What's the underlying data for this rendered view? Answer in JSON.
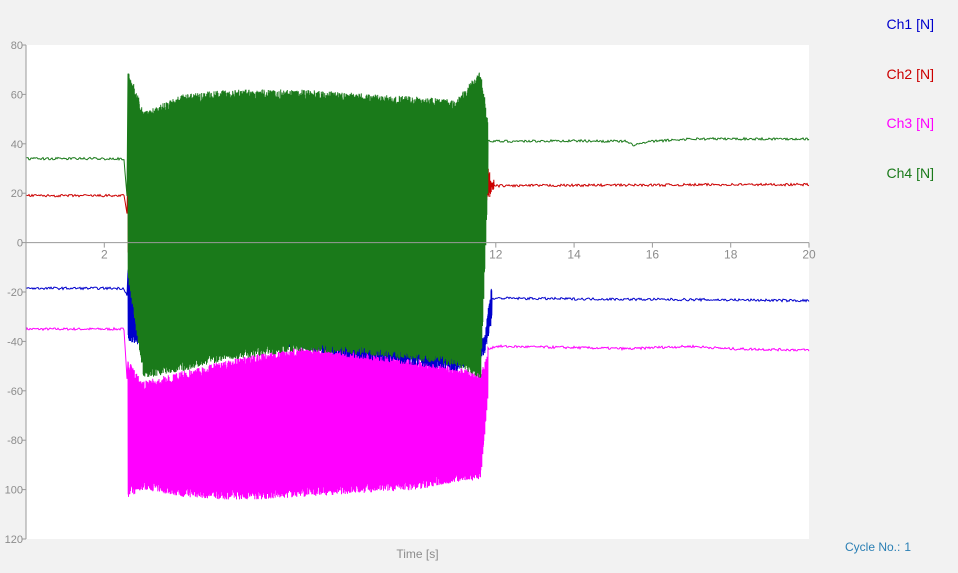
{
  "chart_data": {
    "type": "line",
    "title": "",
    "xlabel": "Time [s]",
    "ylabel": "",
    "xlim": [
      0,
      20
    ],
    "ylim": [
      -120,
      80
    ],
    "xticks": [
      2,
      12,
      14,
      16,
      18,
      20
    ],
    "yticks": [
      80,
      60,
      40,
      20,
      0,
      -20,
      -40,
      -60,
      -80,
      -100,
      -120
    ],
    "ytick_labels": [
      "80",
      "60",
      "40",
      "20",
      "0",
      "-20",
      "-40",
      "-60",
      "-80",
      "100",
      "120"
    ],
    "grid": false,
    "legend": "right",
    "series": [
      {
        "name": "Ch1 [N]",
        "color": "#0000cc",
        "points": [
          [
            0,
            -18.5
          ],
          [
            2.5,
            -18.5
          ],
          [
            2.6,
            -22
          ],
          [
            3,
            -28
          ],
          [
            4,
            -30
          ],
          [
            5,
            -33
          ],
          [
            6,
            -35
          ],
          [
            7,
            -37
          ],
          [
            8,
            -40
          ],
          [
            9,
            -42
          ],
          [
            10,
            -44
          ],
          [
            11,
            -45
          ],
          [
            11.7,
            -44
          ],
          [
            11.9,
            -23
          ],
          [
            12,
            -22.5
          ],
          [
            14,
            -22.8
          ],
          [
            16,
            -23
          ],
          [
            18,
            -23.2
          ],
          [
            20,
            -23.5
          ]
        ],
        "band": [
          [
            2.6,
            -8,
            -40
          ],
          [
            3,
            -14,
            -42
          ],
          [
            4,
            -20,
            -42
          ],
          [
            5,
            -25,
            -41
          ],
          [
            6,
            -28,
            -41
          ],
          [
            7,
            -32,
            -43
          ],
          [
            8,
            -35,
            -46
          ],
          [
            9,
            -38,
            -48
          ],
          [
            10,
            -40,
            -50
          ],
          [
            11,
            -41,
            -52
          ],
          [
            11.7,
            -38,
            -46
          ],
          [
            11.9,
            -15,
            -30
          ]
        ]
      },
      {
        "name": "Ch2 [N]",
        "color": "#cc0000",
        "points": [
          [
            0,
            19
          ],
          [
            2.5,
            19
          ],
          [
            2.6,
            10
          ],
          [
            2.9,
            -12
          ],
          [
            3,
            -15
          ],
          [
            3.2,
            -16
          ],
          [
            4,
            -20
          ],
          [
            6,
            -30
          ],
          [
            8,
            -38
          ],
          [
            10,
            -43
          ],
          [
            11,
            -44
          ],
          [
            11.6,
            -42
          ],
          [
            11.8,
            23
          ],
          [
            12,
            23
          ],
          [
            14,
            23.2
          ],
          [
            16,
            23.3
          ],
          [
            18,
            23.5
          ],
          [
            20,
            23.5
          ]
        ],
        "band": [
          [
            2.6,
            33,
            -5
          ],
          [
            2.8,
            15,
            -20
          ],
          [
            3,
            -2,
            -26
          ],
          [
            3.2,
            -10,
            -30
          ],
          [
            3.4,
            -15,
            -30
          ],
          [
            11.8,
            30,
            17
          ],
          [
            11.95,
            23,
            23
          ]
        ]
      },
      {
        "name": "Ch3 [N]",
        "color": "#ff00ff",
        "points": [
          [
            0,
            -35
          ],
          [
            2.5,
            -35
          ],
          [
            2.6,
            -60
          ],
          [
            3,
            -70
          ],
          [
            5,
            -72
          ],
          [
            7,
            -73
          ],
          [
            9,
            -74
          ],
          [
            11,
            -74
          ],
          [
            11.6,
            -73
          ],
          [
            11.8,
            -43
          ],
          [
            12,
            -42
          ],
          [
            14,
            -42.5
          ],
          [
            15.5,
            -43
          ],
          [
            16,
            -42.5
          ],
          [
            17,
            -42
          ],
          [
            18,
            -43
          ],
          [
            20,
            -43.5
          ]
        ],
        "band": [
          [
            2.6,
            -48,
            -103
          ],
          [
            3,
            -56,
            -100
          ],
          [
            4,
            -52,
            -103
          ],
          [
            5,
            -48,
            -104
          ],
          [
            6,
            -45,
            -104
          ],
          [
            7,
            -42,
            -103
          ],
          [
            8,
            -42,
            -102
          ],
          [
            9,
            -44,
            -101
          ],
          [
            10,
            -47,
            -100
          ],
          [
            11,
            -50,
            -97
          ],
          [
            11.6,
            -53,
            -96
          ],
          [
            11.8,
            -45,
            -60
          ]
        ]
      },
      {
        "name": "Ch4 [N]",
        "color": "#1a7a1a",
        "points": [
          [
            0,
            34
          ],
          [
            2.5,
            34
          ],
          [
            2.6,
            15
          ],
          [
            3,
            10
          ],
          [
            5,
            8
          ],
          [
            7,
            6
          ],
          [
            9,
            5
          ],
          [
            11,
            5
          ],
          [
            11.6,
            5
          ],
          [
            11.8,
            41
          ],
          [
            12,
            41
          ],
          [
            14,
            41.2
          ],
          [
            15.3,
            41
          ],
          [
            15.5,
            39.5
          ],
          [
            16,
            41
          ],
          [
            17,
            42
          ],
          [
            18,
            42
          ],
          [
            20,
            42
          ]
        ],
        "band": [
          [
            2.6,
            70,
            -15
          ],
          [
            3,
            53,
            -55
          ],
          [
            4,
            60,
            -52
          ],
          [
            5,
            62,
            -48
          ],
          [
            6,
            62,
            -46
          ],
          [
            7,
            62,
            -44
          ],
          [
            8,
            61,
            -45
          ],
          [
            9,
            60,
            -46
          ],
          [
            10,
            59,
            -48
          ],
          [
            11,
            58,
            -50
          ],
          [
            11.6,
            70,
            -55
          ],
          [
            11.8,
            48,
            30
          ]
        ]
      }
    ]
  },
  "footer": {
    "cycle_label": "Cycle No.:",
    "cycle_value": "1"
  }
}
